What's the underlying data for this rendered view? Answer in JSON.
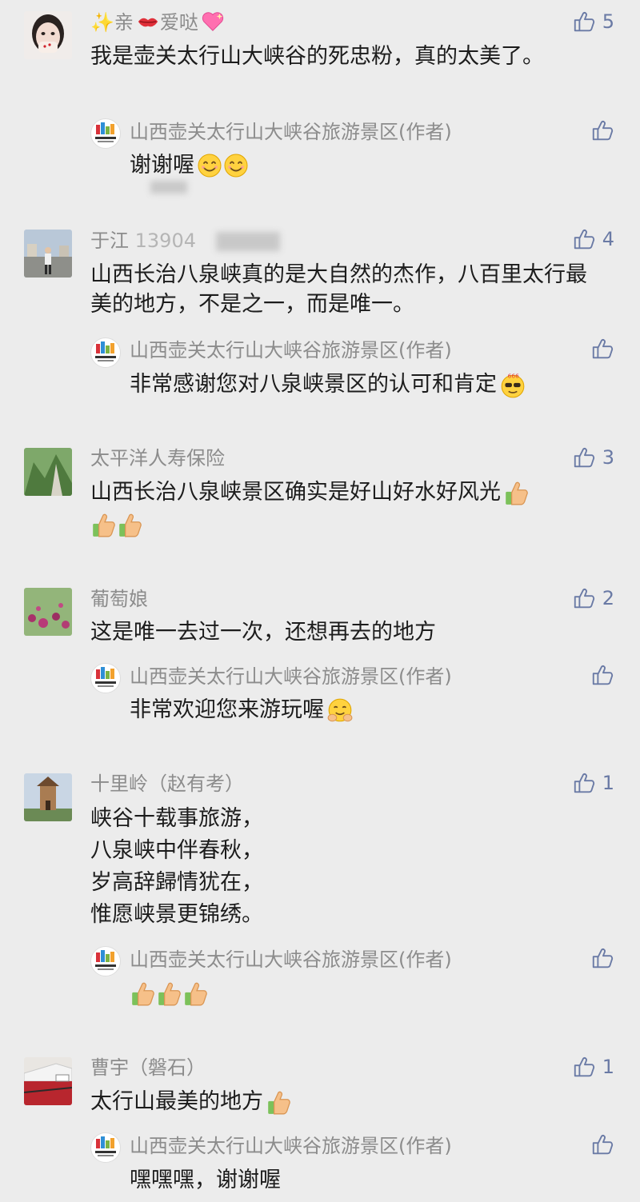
{
  "author_name": "山西壶关太行山大峡谷旅游景区(作者)",
  "comments": [
    {
      "nick": "亲",
      "nick_suffix": "爱哒",
      "likes": "5",
      "text": "我是壶关太行山大峡谷的死忠粉，真的太美了。",
      "reply": "谢谢喔"
    },
    {
      "nick": "于江",
      "nick_blurred_prefix": "13904",
      "likes": "4",
      "text": "山西长治八泉峡真的是大自然的杰作，八百里太行最美的地方，不是之一，而是唯一。",
      "reply": "非常感谢您对八泉峡景区的认可和肯定"
    },
    {
      "nick": "太平洋人寿保险",
      "likes": "3",
      "text": "山西长治八泉峡景区确实是好山好水好风光"
    },
    {
      "nick": "葡萄娘",
      "likes": "2",
      "text": "这是唯一去过一次，还想再去的地方",
      "reply": "非常欢迎您来游玩喔"
    },
    {
      "nick": "十里岭（赵有考）",
      "likes": "1",
      "lines": [
        "峡谷十载事旅游，",
        "八泉峡中伴春秋，",
        "岁高辞歸情犹在，",
        "惟愿峡景更锦绣。"
      ]
    },
    {
      "nick": "曹宇（磐石）",
      "likes": "1",
      "text": "太行山最美的地方",
      "reply": "嘿嘿嘿，谢谢喔"
    }
  ],
  "icons": {
    "like": "thumbs-up-outline-icon",
    "thumbs_emoji": "thumbs-up-emoji-icon",
    "smile_emoji": "smile-emoji-icon",
    "cool_emoji": "sunglasses-666-emoji-icon",
    "hug_emoji": "hug-emoji-icon",
    "kiss_emoji": "kiss-lips-icon",
    "heart_emoji": "sparkling-heart-icon"
  },
  "colors": {
    "background": "#ececec",
    "nickname": "#8c8c8c",
    "like_icon": "#6a7aa5"
  }
}
